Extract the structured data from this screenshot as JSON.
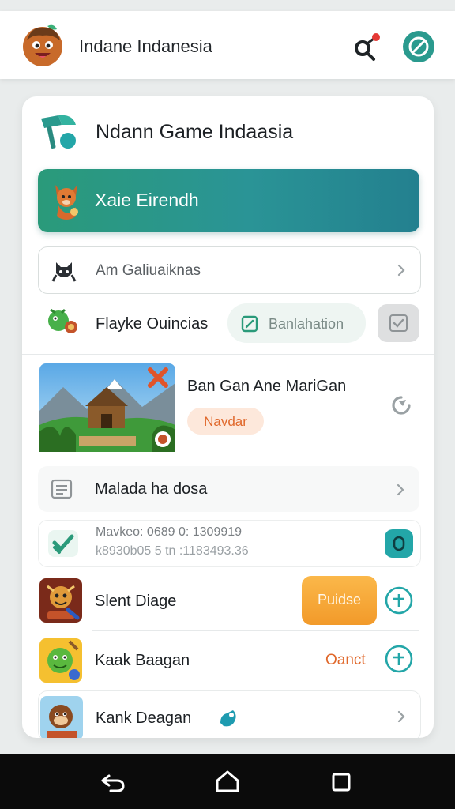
{
  "header": {
    "title": "Indane Indanesia"
  },
  "card": {
    "title": "Ndann Game Indaasia",
    "hero_label": "Xaie Eirendh",
    "search_row_label": "Am Galiuaiknas",
    "player_row_label": "Flayke Ouincias",
    "player_pill_label": "Banlahation",
    "feature": {
      "title": "Ban Gan Ane MariGan",
      "badge": "Navdar"
    },
    "menu_row_label": "Malada ha dosa",
    "info": {
      "line1": "Mavkeo: 0689 0: 1309919",
      "line2": "k8930b05 5 tn :1183493.36"
    },
    "items": [
      {
        "label": "Slent Diage",
        "action": "Puidse"
      },
      {
        "label": "Kaak Baagan",
        "action": "Oanct"
      },
      {
        "label": "Kank Deagan"
      }
    ]
  },
  "colors": {
    "teal": "#2a9496",
    "orange": "#f7a736",
    "badge_bg": "#fde8db",
    "badge_text": "#e0682b"
  }
}
